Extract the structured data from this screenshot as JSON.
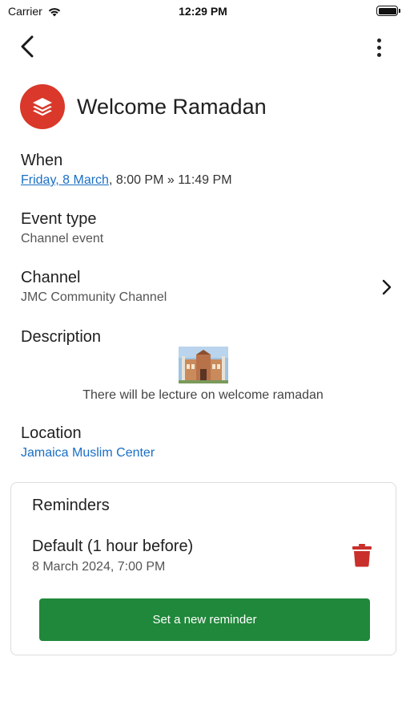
{
  "status_bar": {
    "carrier": "Carrier",
    "time": "12:29 PM"
  },
  "header": {
    "back_icon": "chevron-left-icon",
    "more_icon": "more-vertical-icon"
  },
  "event": {
    "title": "Welcome Ramadan",
    "avatar_icon": "layers-icon",
    "avatar_color": "#d9382a"
  },
  "when": {
    "label": "When",
    "date_link": "Friday, 8 March",
    "time_range": ", 8:00 PM » 11:49 PM"
  },
  "event_type": {
    "label": "Event type",
    "value": "Channel event"
  },
  "channel": {
    "label": "Channel",
    "value": "JMC Community Channel"
  },
  "description": {
    "label": "Description",
    "text": "There will be lecture on welcome ramadan"
  },
  "location": {
    "label": "Location",
    "value": "Jamaica Muslim Center"
  },
  "reminders": {
    "title": "Reminders",
    "items": [
      {
        "name": "Default (1 hour before)",
        "datetime": "8 March 2024, 7:00 PM"
      }
    ],
    "new_button_label": "Set a new reminder",
    "button_color": "#1f883a",
    "delete_color": "#c9302c"
  },
  "colors": {
    "link": "#1a6fc4"
  }
}
